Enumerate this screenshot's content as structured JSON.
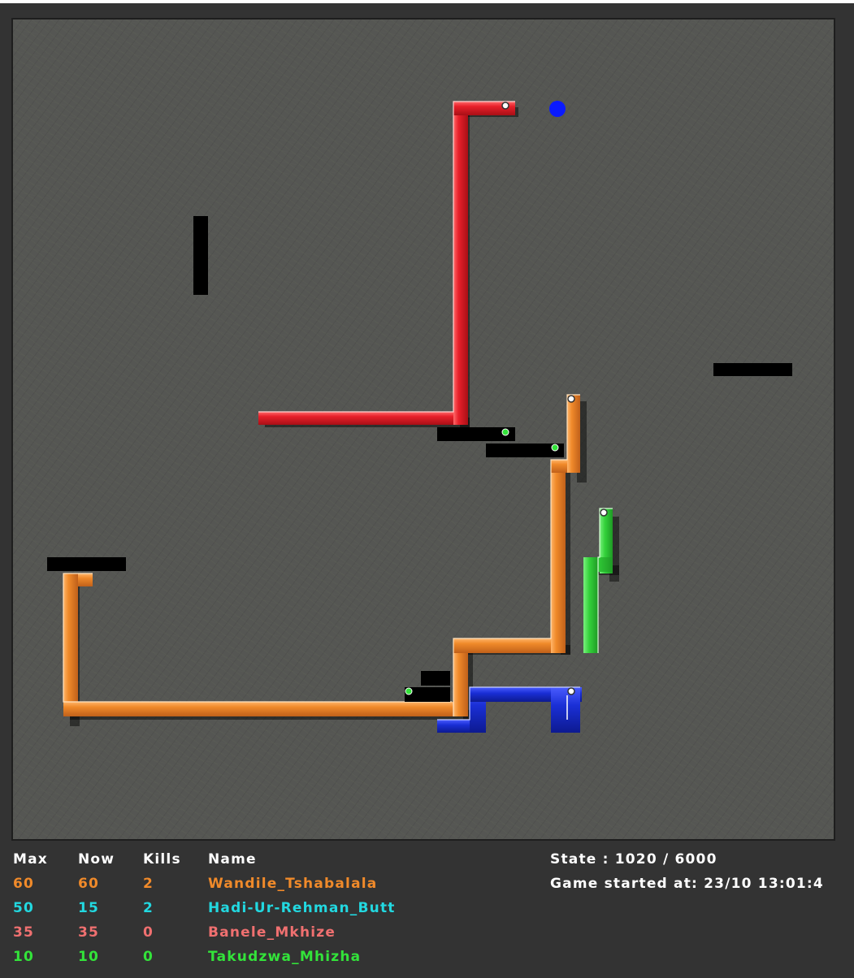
{
  "scoreboard": {
    "headers": {
      "max": "Max",
      "now": "Now",
      "kills": "Kills",
      "name": "Name"
    },
    "players": [
      {
        "max": "60",
        "now": "60",
        "kills": "2",
        "name": "Wandile_Tshabalala",
        "color": "#f08a2a"
      },
      {
        "max": "50",
        "now": "15",
        "kills": "2",
        "name": "Hadi-Ur-Rehman_Butt",
        "color": "#22d8e0"
      },
      {
        "max": "35",
        "now": "35",
        "kills": "0",
        "name": "Banele_Mkhize",
        "color": "#f07070"
      },
      {
        "max": "10",
        "now": "10",
        "kills": "0",
        "name": "Takudzwa_Mhizha",
        "color": "#33e33a"
      }
    ]
  },
  "status": {
    "state": "State : 1020 / 6000",
    "started": "Game started at: 23/10 13:01:4"
  },
  "board": {
    "background": "#555653",
    "snake_colors": {
      "red": "#e8202a",
      "orange": "#f08a2a",
      "blue": "#1a2fd6",
      "green": "#33d23a"
    },
    "obstacle_color": "#000000",
    "apple_color": "#0a1aff",
    "zombie_head_color": "#33e33a"
  }
}
